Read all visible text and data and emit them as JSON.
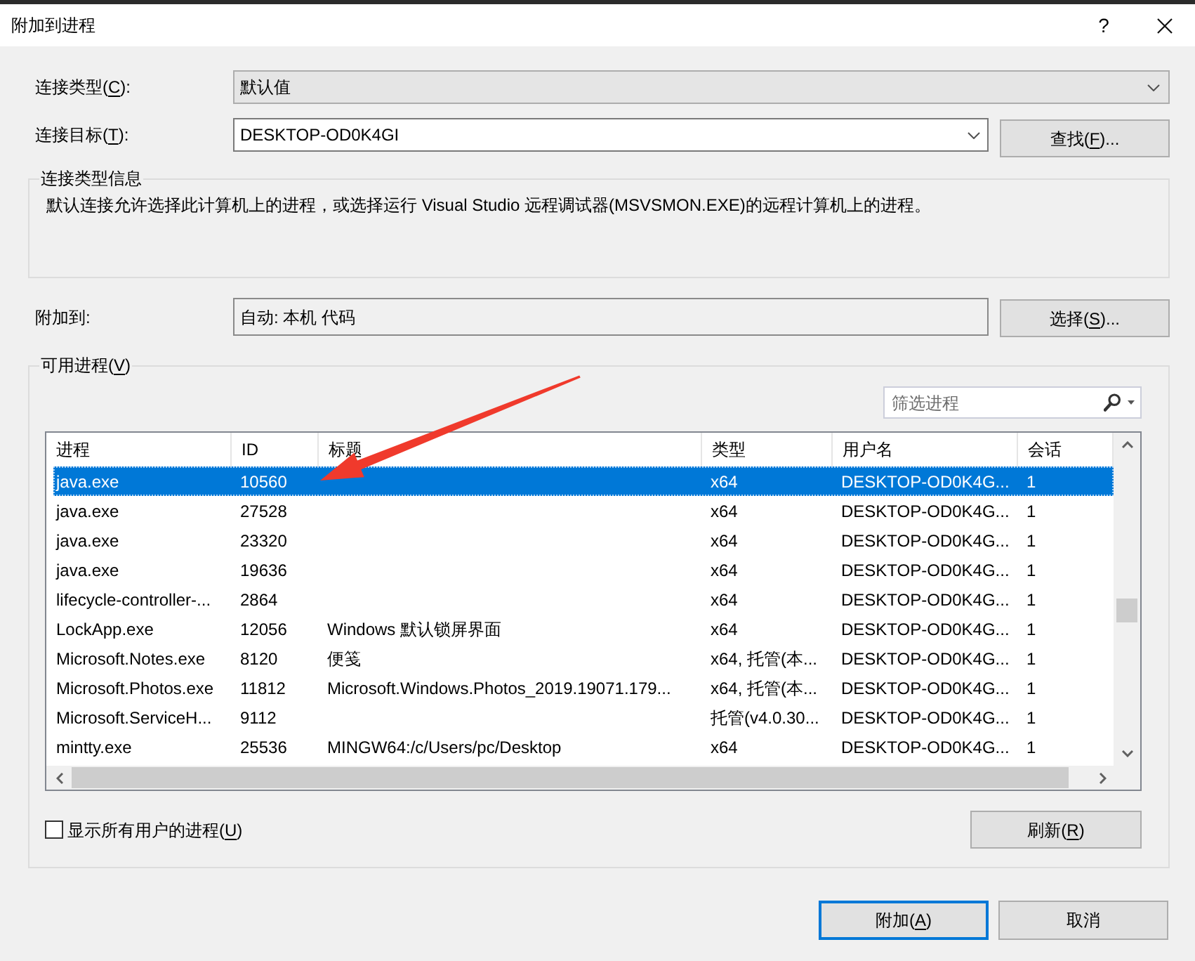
{
  "window": {
    "title": "附加到进程",
    "help": "?"
  },
  "connection_type": {
    "label": {
      "before": "连接类型(",
      "key": "C",
      "after": "):"
    },
    "value": "默认值"
  },
  "connection_target": {
    "label": {
      "before": "连接目标(",
      "key": "T",
      "after": "):"
    },
    "value": "DESKTOP-OD0K4GI",
    "find_button": {
      "before": "查找(",
      "key": "F",
      "after": ")..."
    }
  },
  "connection_info": {
    "title": "连接类型信息",
    "text": "默认连接允许选择此计算机上的进程，或选择运行 Visual Studio 远程调试器(MSVSMON.EXE)的远程计算机上的进程。"
  },
  "attach_to": {
    "label": "附加到:",
    "value": "自动: 本机 代码",
    "select_button": {
      "before": "选择(",
      "key": "S",
      "after": ")..."
    }
  },
  "available_processes": {
    "title": {
      "before": "可用进程(",
      "key": "V",
      "after": ")"
    },
    "filter": {
      "placeholder": "筛选进程"
    },
    "table": {
      "columns": [
        "进程",
        "ID",
        "标题",
        "类型",
        "用户名",
        "会话"
      ],
      "rows": [
        {
          "process": "java.exe",
          "id": "10560",
          "type": "x64",
          "user": "DESKTOP-OD0K4G...",
          "session": "1",
          "selected": true
        },
        {
          "process": "java.exe",
          "id": "27528",
          "type": "x64",
          "user": "DESKTOP-OD0K4G...",
          "session": "1",
          "selected": false
        },
        {
          "process": "java.exe",
          "id": "23320",
          "type": "x64",
          "user": "DESKTOP-OD0K4G...",
          "session": "1",
          "selected": false
        },
        {
          "process": "java.exe",
          "id": "19636",
          "type": "x64",
          "user": "DESKTOP-OD0K4G...",
          "session": "1",
          "selected": false
        },
        {
          "process": "lifecycle-controller-...",
          "id": "2864",
          "type": "x64",
          "user": "DESKTOP-OD0K4G...",
          "session": "1",
          "selected": false
        },
        {
          "process": "LockApp.exe",
          "id": "12056",
          "title": "Windows 默认锁屏界面",
          "type": "x64",
          "user": "DESKTOP-OD0K4G...",
          "session": "1",
          "selected": false
        },
        {
          "process": "Microsoft.Notes.exe",
          "id": "8120",
          "title": "便笺",
          "type": "x64, 托管(本...",
          "user": "DESKTOP-OD0K4G...",
          "session": "1",
          "selected": false
        },
        {
          "process": "Microsoft.Photos.exe",
          "id": "11812",
          "title": "Microsoft.Windows.Photos_2019.19071.179...",
          "type": "x64, 托管(本...",
          "user": "DESKTOP-OD0K4G...",
          "session": "1",
          "selected": false
        },
        {
          "process": "Microsoft.ServiceH...",
          "id": "9112",
          "type": "托管(v4.0.30...",
          "user": "DESKTOP-OD0K4G...",
          "session": "1",
          "selected": false
        },
        {
          "process": "mintty.exe",
          "id": "25536",
          "title": "MINGW64:/c/Users/pc/Desktop",
          "type": "x64",
          "user": "DESKTOP-OD0K4G...",
          "session": "1",
          "selected": false
        }
      ]
    },
    "show_all_users": {
      "label": {
        "before": "显示所有用户的进程(",
        "key": "U",
        "after": ")"
      },
      "checked": false
    },
    "refresh_button": {
      "before": "刷新(",
      "key": "R",
      "after": ")"
    }
  },
  "buttons": [
    {
      "label": {
        "before": "附加(",
        "key": "A",
        "after": ")"
      },
      "default": true
    },
    {
      "label": {
        "before": "取消"
      },
      "default": false
    }
  ]
}
